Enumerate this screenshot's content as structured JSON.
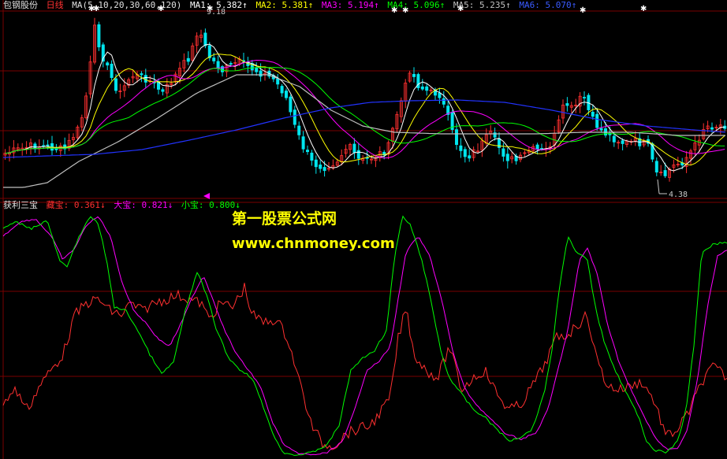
{
  "top_panel": {
    "stock_name": "包钢股份",
    "period": "日线",
    "ma_params": "MA(5,10,20,30,60,120)",
    "indicators": [
      {
        "label": "MA1: 5.382↑",
        "color": "#ffffff"
      },
      {
        "label": "MA2: 5.381↑",
        "color": "#ffff00"
      },
      {
        "label": "MA3: 5.194↑",
        "color": "#ff00ff"
      },
      {
        "label": "MA4: 5.096↑",
        "color": "#00ff00"
      },
      {
        "label": "MA5: 5.235↑",
        "color": "#c0c0c0"
      },
      {
        "label": "MA6: 5.070↑",
        "color": "#3a5bff"
      }
    ],
    "high_label": "9.18",
    "low_label": "4.38"
  },
  "bottom_panel": {
    "name": "获利三宝",
    "indicators": [
      {
        "label": "藏宝: 0.361↓",
        "color": "#ff3030"
      },
      {
        "label": "大宝: 0.821↓",
        "color": "#ff00ff"
      },
      {
        "label": "小宝: 0.800↓",
        "color": "#00ff00"
      }
    ]
  },
  "watermark": {
    "line1": "第一股票公式网",
    "line2": "www.chnmoney.com"
  },
  "colors": {
    "up": "#ff3030",
    "down": "#00e5ee",
    "ma1": "#ffffff",
    "ma2": "#ffff00",
    "ma3": "#ff00ff",
    "ma4": "#00ff00",
    "ma5": "#c0c0c0",
    "ma6": "#2233ff",
    "grid": "#7a0000",
    "watermark": "#ffff00"
  }
}
